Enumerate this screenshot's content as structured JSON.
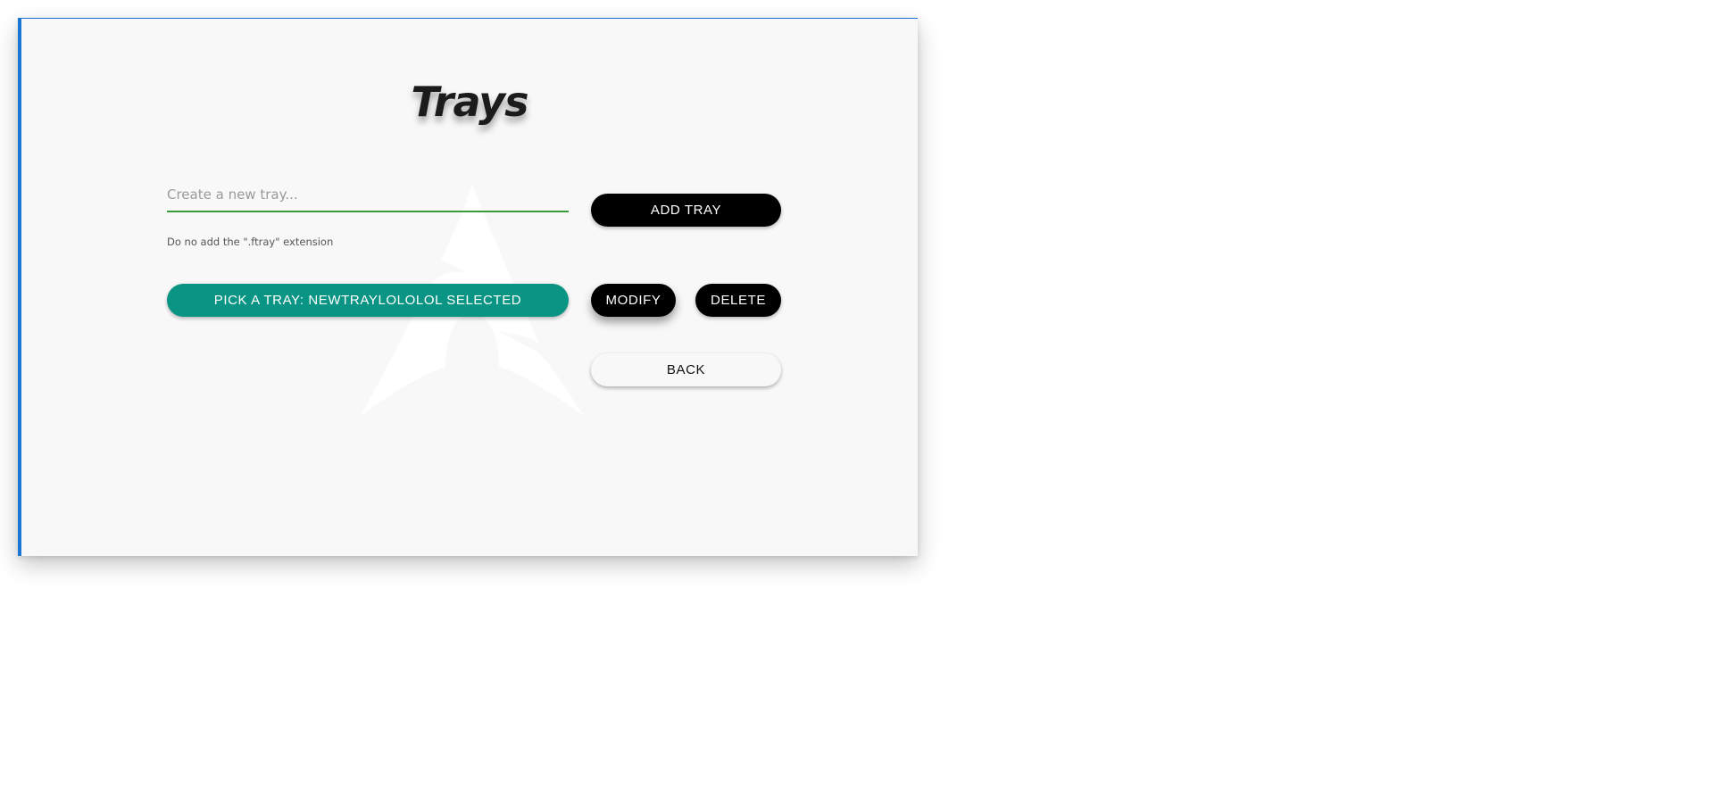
{
  "page": {
    "title": "Trays"
  },
  "new_tray": {
    "placeholder": "Create a new tray...",
    "value": "",
    "hint": "Do no add the \".ftray\" extension",
    "add_label": "ADD TRAY"
  },
  "actions": {
    "pick_label": "PICK A TRAY: NEWTRAYLOLOLOL SELECTED",
    "modify_label": "MODIFY",
    "delete_label": "DELETE",
    "back_label": "BACK"
  },
  "colors": {
    "accent_border": "#1976d2",
    "input_underline": "#3a9a3a",
    "pick_button": "#0a9484",
    "primary_button": "#000000",
    "window_bg": "#f8f8f8"
  },
  "icons": {
    "watermark": "arch-logo-icon"
  }
}
